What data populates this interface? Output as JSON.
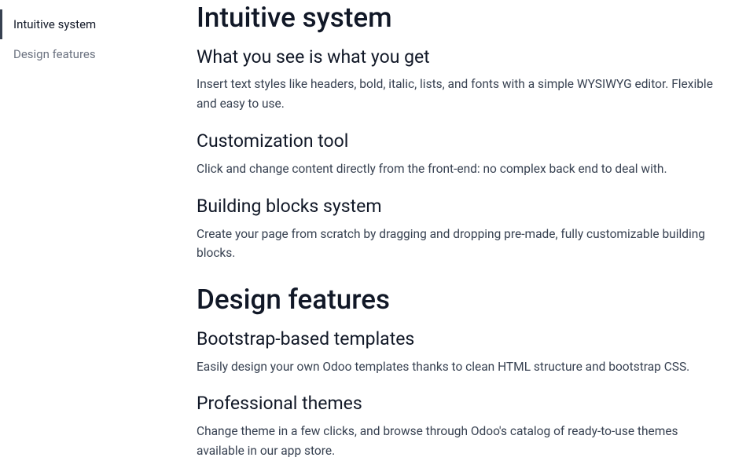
{
  "sidebar": {
    "items": [
      {
        "label": "Intuitive system",
        "active": true
      },
      {
        "label": "Design features",
        "active": false
      }
    ]
  },
  "sections": [
    {
      "title": "Intuitive system",
      "subsections": [
        {
          "title": "What you see is what you get",
          "body": "Insert text styles like headers, bold, italic, lists, and fonts with a simple WYSIWYG editor. Flexible and easy to use."
        },
        {
          "title": "Customization tool",
          "body": "Click and change content directly from the front-end: no complex back end to deal with."
        },
        {
          "title": "Building blocks system",
          "body": "Create your page from scratch by dragging and dropping pre-made, fully customizable building blocks."
        }
      ]
    },
    {
      "title": "Design features",
      "subsections": [
        {
          "title": "Bootstrap-based templates",
          "body": "Easily design your own Odoo templates thanks to clean HTML structure and bootstrap CSS."
        },
        {
          "title": "Professional themes",
          "body": "Change theme in a few clicks, and browse through Odoo's catalog of ready-to-use themes available in our app store."
        }
      ]
    }
  ]
}
